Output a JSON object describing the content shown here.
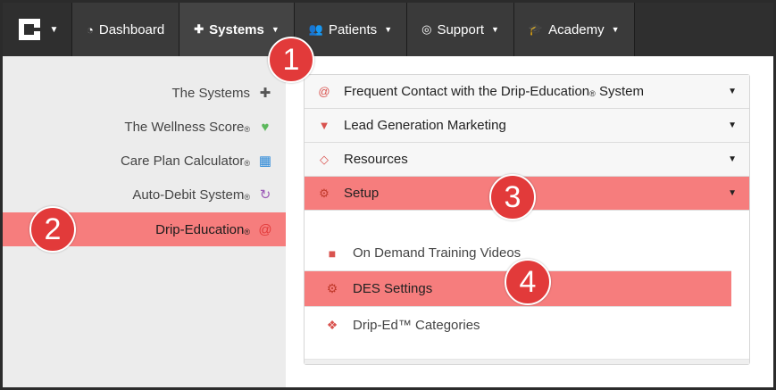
{
  "nav": {
    "items": [
      {
        "label": "Dashboard",
        "icon": "dashboard-icon"
      },
      {
        "label": "Systems",
        "icon": "puzzle-icon"
      },
      {
        "label": "Patients",
        "icon": "users-icon"
      },
      {
        "label": "Support",
        "icon": "lifebuoy-icon"
      },
      {
        "label": "Academy",
        "icon": "graduation-cap-icon"
      }
    ]
  },
  "sidebar": {
    "items": [
      {
        "label": "The Systems",
        "reg": "",
        "icon": "puzzle-icon",
        "icon_color": "#555555"
      },
      {
        "label": "The Wellness Score",
        "reg": "®",
        "icon": "heartbeat-icon",
        "icon_color": "#5cb85c"
      },
      {
        "label": "Care Plan Calculator",
        "reg": "®",
        "icon": "calculator-icon",
        "icon_color": "#2a88d8"
      },
      {
        "label": "Auto-Debit System",
        "reg": "®",
        "icon": "refresh-icon",
        "icon_color": "#9b59b6"
      },
      {
        "label": "Drip-Education",
        "reg": "®",
        "icon": "at-icon",
        "icon_color": "#e23a3a"
      }
    ]
  },
  "accordion": {
    "rows": [
      {
        "label": "Frequent Contact with the Drip-Education",
        "reg": "®",
        "label_tail": " System",
        "icon": "at-icon"
      },
      {
        "label": "Lead Generation Marketing",
        "reg": "",
        "label_tail": "",
        "icon": "filter-icon"
      },
      {
        "label": "Resources",
        "reg": "",
        "label_tail": "",
        "icon": "diamond-icon"
      },
      {
        "label": "Setup",
        "reg": "",
        "label_tail": "",
        "icon": "gears-icon"
      }
    ],
    "sub_items": [
      {
        "label": "On Demand Training Videos",
        "icon": "video-camera-icon"
      },
      {
        "label": "DES Settings",
        "icon": "gear-icon"
      },
      {
        "label": "Drip-Ed™ Categories",
        "icon": "cubes-icon"
      }
    ]
  },
  "callouts": [
    "1",
    "2",
    "3",
    "4"
  ],
  "colors": {
    "highlight": "#f67d7d",
    "callout": "#e23a3a",
    "nav_bg": "#2f2f2f"
  }
}
